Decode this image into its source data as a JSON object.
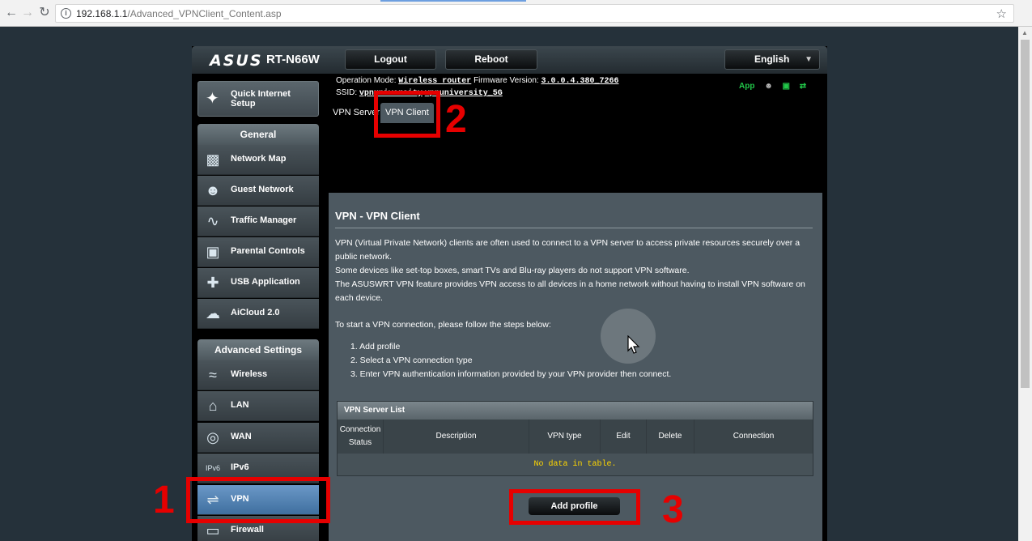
{
  "browser": {
    "back_icon": "arrow-left-icon",
    "forward_icon": "arrow-right-icon",
    "reload_icon": "reload-icon",
    "url_host": "192.168.1.1",
    "url_path": "/Advanced_VPNClient_Content.asp",
    "star_icon": "star-icon"
  },
  "header": {
    "logo": "ASUS",
    "model": "RT-N66W",
    "logout": "Logout",
    "reboot": "Reboot",
    "language": "English"
  },
  "info": {
    "op_mode_label": "Operation Mode:",
    "op_mode_value": "Wireless router",
    "fw_label": "Firmware Version:",
    "fw_value": "3.0.0.4.380_7266",
    "ssid_label": "SSID:",
    "ssid_value_1": "vpnuniversity",
    "ssid_value_2": "vpnuniversity_5G",
    "app_label": "App"
  },
  "tabs": {
    "vpn_server": "VPN Server",
    "vpn_client": "VPN Client"
  },
  "sidebar": {
    "qis": "Quick Internet Setup",
    "general_title": "General",
    "general": [
      {
        "label": "Network Map",
        "icon": "network-map-icon"
      },
      {
        "label": "Guest Network",
        "icon": "guest-network-icon"
      },
      {
        "label": "Traffic Manager",
        "icon": "traffic-manager-icon"
      },
      {
        "label": "Parental Controls",
        "icon": "lock-icon"
      },
      {
        "label": "USB Application",
        "icon": "puzzle-icon"
      },
      {
        "label": "AiCloud 2.0",
        "icon": "cloud-icon"
      }
    ],
    "advanced_title": "Advanced Settings",
    "advanced": [
      {
        "label": "Wireless",
        "icon": "wifi-icon"
      },
      {
        "label": "LAN",
        "icon": "home-icon"
      },
      {
        "label": "WAN",
        "icon": "globe-icon"
      },
      {
        "label": "IPv6",
        "icon": "ipv6-icon"
      },
      {
        "label": "VPN",
        "icon": "vpn-icon"
      },
      {
        "label": "Firewall",
        "icon": "shield-icon"
      }
    ]
  },
  "content": {
    "title": "VPN - VPN Client",
    "p1": "VPN (Virtual Private Network) clients are often used to connect to a VPN server to access private resources securely over a public network.",
    "p2": "Some devices like set-top boxes, smart TVs and Blu-ray players do not support VPN software.",
    "p3": "The ASUSWRT VPN feature provides VPN access to all devices in a home network without having to install VPN software on each device.",
    "p4": "To start a VPN connection, please follow the steps below:",
    "steps": [
      "1. Add profile",
      "2. Select a VPN connection type",
      "3. Enter VPN authentication information provided by your VPN provider then connect."
    ],
    "table_title": "VPN Server List",
    "columns": [
      "Connection Status",
      "Description",
      "VPN type",
      "Edit",
      "Delete",
      "Connection"
    ],
    "no_data": "No data in table.",
    "add_profile": "Add profile"
  },
  "annotations": {
    "n1": "1",
    "n2": "2",
    "n3": "3",
    "color": "#e60000"
  }
}
